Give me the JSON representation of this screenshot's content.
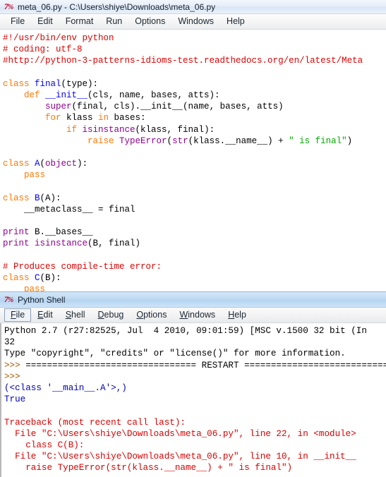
{
  "editor": {
    "icon": "python-idle-icon",
    "title": "meta_06.py - C:\\Users\\shiye\\Downloads\\meta_06.py",
    "menu": [
      {
        "label": "File"
      },
      {
        "label": "Edit"
      },
      {
        "label": "Format"
      },
      {
        "label": "Run"
      },
      {
        "label": "Options"
      },
      {
        "label": "Windows"
      },
      {
        "label": "Help"
      }
    ],
    "code_lines": [
      [
        {
          "t": "#!/usr/bin/env python",
          "c": "c-comment"
        }
      ],
      [
        {
          "t": "# coding: utf-8",
          "c": "c-comment"
        }
      ],
      [
        {
          "t": "#http://python-3-patterns-idioms-test.readthedocs.org/en/latest/Meta",
          "c": "c-comment"
        }
      ],
      [
        {
          "t": "",
          "c": "c-plain"
        }
      ],
      [
        {
          "t": "class ",
          "c": "c-keyword"
        },
        {
          "t": "final",
          "c": "c-def"
        },
        {
          "t": "(type):",
          "c": "c-plain"
        }
      ],
      [
        {
          "t": "    def ",
          "c": "c-keyword"
        },
        {
          "t": "__init__",
          "c": "c-def"
        },
        {
          "t": "(cls, name, bases, atts):",
          "c": "c-plain"
        }
      ],
      [
        {
          "t": "        ",
          "c": "c-plain"
        },
        {
          "t": "super",
          "c": "c-builtin"
        },
        {
          "t": "(final, cls).__init__(name, bases, atts)",
          "c": "c-plain"
        }
      ],
      [
        {
          "t": "        for ",
          "c": "c-keyword"
        },
        {
          "t": "klass ",
          "c": "c-plain"
        },
        {
          "t": "in ",
          "c": "c-keyword"
        },
        {
          "t": "bases:",
          "c": "c-plain"
        }
      ],
      [
        {
          "t": "            if ",
          "c": "c-keyword"
        },
        {
          "t": "isinstance",
          "c": "c-builtin"
        },
        {
          "t": "(klass, final):",
          "c": "c-plain"
        }
      ],
      [
        {
          "t": "                raise ",
          "c": "c-keyword"
        },
        {
          "t": "TypeError",
          "c": "c-builtin"
        },
        {
          "t": "(",
          "c": "c-plain"
        },
        {
          "t": "str",
          "c": "c-builtin"
        },
        {
          "t": "(klass.__name__) + ",
          "c": "c-plain"
        },
        {
          "t": "\" is final\"",
          "c": "c-string"
        },
        {
          "t": ")",
          "c": "c-plain"
        }
      ],
      [
        {
          "t": "",
          "c": "c-plain"
        }
      ],
      [
        {
          "t": "class ",
          "c": "c-keyword"
        },
        {
          "t": "A",
          "c": "c-def"
        },
        {
          "t": "(",
          "c": "c-plain"
        },
        {
          "t": "object",
          "c": "c-builtin"
        },
        {
          "t": "):",
          "c": "c-plain"
        }
      ],
      [
        {
          "t": "    pass",
          "c": "c-keyword"
        }
      ],
      [
        {
          "t": "",
          "c": "c-plain"
        }
      ],
      [
        {
          "t": "class ",
          "c": "c-keyword"
        },
        {
          "t": "B",
          "c": "c-def"
        },
        {
          "t": "(A):",
          "c": "c-plain"
        }
      ],
      [
        {
          "t": "    __metaclass__ = final",
          "c": "c-plain"
        }
      ],
      [
        {
          "t": "",
          "c": "c-plain"
        }
      ],
      [
        {
          "t": "print ",
          "c": "c-builtin"
        },
        {
          "t": "B.__bases__",
          "c": "c-plain"
        }
      ],
      [
        {
          "t": "print ",
          "c": "c-builtin"
        },
        {
          "t": "isinstance",
          "c": "c-builtin"
        },
        {
          "t": "(B, final)",
          "c": "c-plain"
        }
      ],
      [
        {
          "t": "",
          "c": "c-plain"
        }
      ],
      [
        {
          "t": "# Produces compile-time error:",
          "c": "c-comment"
        }
      ],
      [
        {
          "t": "class ",
          "c": "c-keyword"
        },
        {
          "t": "C",
          "c": "c-def"
        },
        {
          "t": "(B):",
          "c": "c-plain"
        }
      ],
      [
        {
          "t": "    pass",
          "c": "c-keyword"
        }
      ]
    ]
  },
  "shell": {
    "icon": "python-idle-icon",
    "title": "Python Shell",
    "menu": [
      {
        "label": "File",
        "accel": "F",
        "focused": true
      },
      {
        "label": "Edit",
        "accel": "E",
        "focused": false
      },
      {
        "label": "Shell",
        "accel": "S",
        "focused": false
      },
      {
        "label": "Debug",
        "accel": "D",
        "focused": false
      },
      {
        "label": "Options",
        "accel": "O",
        "focused": false
      },
      {
        "label": "Windows",
        "accel": "W",
        "focused": false
      },
      {
        "label": "Help",
        "accel": "H",
        "focused": false
      }
    ],
    "output_lines": [
      [
        {
          "t": "Python 2.7 (r27:82525, Jul  4 2010, 09:01:59) [MSC v.1500 32 bit (In",
          "c": "s-stdout"
        }
      ],
      [
        {
          "t": "32",
          "c": "s-stdout"
        }
      ],
      [
        {
          "t": "Type \"copyright\", \"credits\" or \"license()\" for more information.",
          "c": "s-stdout"
        }
      ],
      [
        {
          "t": ">>> ",
          "c": "s-prompt"
        },
        {
          "t": "================================ RESTART ================================",
          "c": "s-stdout"
        }
      ],
      [
        {
          "t": ">>> ",
          "c": "s-prompt"
        }
      ],
      [
        {
          "t": "(<class '__main__.A'>,)",
          "c": "s-ret"
        }
      ],
      [
        {
          "t": "True",
          "c": "s-ret"
        }
      ],
      [
        {
          "t": "",
          "c": "s-stdout"
        }
      ],
      [
        {
          "t": "Traceback (most recent call last):",
          "c": "s-err"
        }
      ],
      [
        {
          "t": "  File \"C:\\Users\\shiye\\Downloads\\meta_06.py\", line 22, in <module>",
          "c": "s-err"
        }
      ],
      [
        {
          "t": "    class C(B):",
          "c": "s-err"
        }
      ],
      [
        {
          "t": "  File \"C:\\Users\\shiye\\Downloads\\meta_06.py\", line 10, in __init__",
          "c": "s-err"
        }
      ],
      [
        {
          "t": "    raise TypeError(str(klass.__name__) + \" is final\")",
          "c": "s-err"
        }
      ]
    ]
  }
}
